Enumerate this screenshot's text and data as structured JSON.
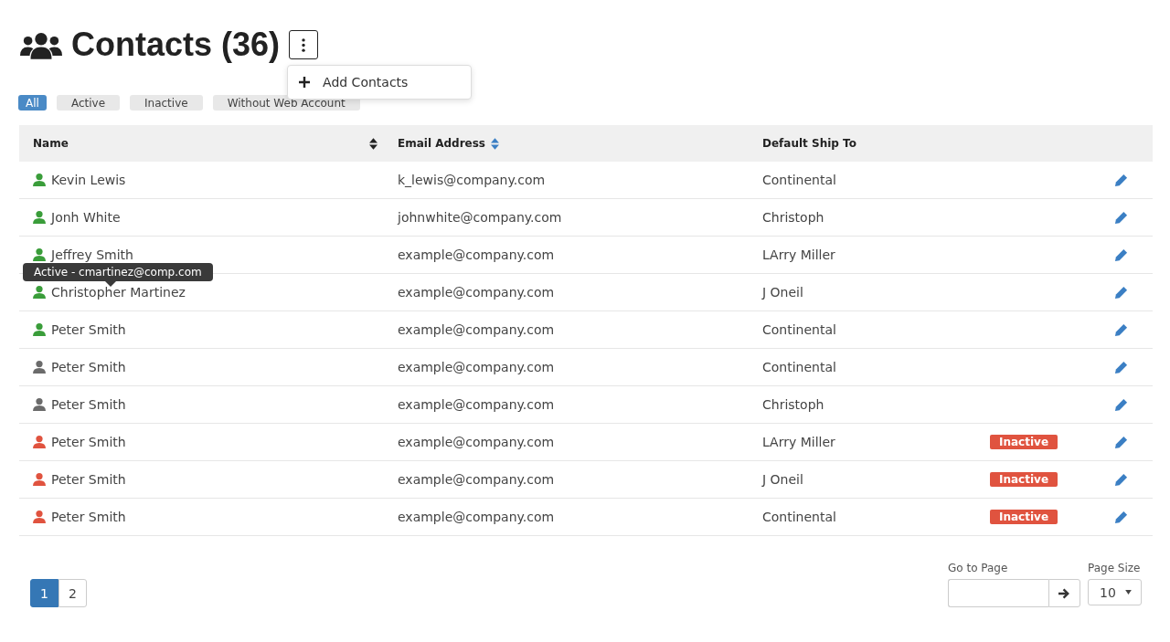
{
  "header": {
    "title": "Contacts (36)",
    "menu": [
      {
        "label": "Add Contacts"
      }
    ]
  },
  "filters": [
    {
      "label": "All",
      "selected": true
    },
    {
      "label": "Active",
      "selected": false
    },
    {
      "label": "Inactive",
      "selected": false
    },
    {
      "label": "Without Web Account",
      "selected": false
    }
  ],
  "table": {
    "columns": [
      {
        "label": "Name",
        "sorted": false
      },
      {
        "label": "Email Address",
        "sorted": true
      },
      {
        "label": "Default Ship To"
      }
    ],
    "rows": [
      {
        "name": "Kevin Lewis",
        "color": "#3a9d3a",
        "email": "k_lewis@company.com",
        "ship_to": "Continental"
      },
      {
        "name": "Jonh White",
        "color": "#3a9d3a",
        "email": "johnwhite@company.com",
        "ship_to": "Christoph"
      },
      {
        "name": "Jeffrey Smith",
        "color": "#3a9d3a",
        "email": "example@company.com",
        "ship_to": "LArry Miller"
      },
      {
        "name": "Christopher Martinez",
        "color": "#3a9d3a",
        "email": "example@company.com",
        "ship_to": "J Oneil"
      },
      {
        "name": "Peter Smith",
        "color": "#3a9d3a",
        "email": "example@company.com",
        "ship_to": "Continental"
      },
      {
        "name": "Peter Smith",
        "color": "#6b6b6b",
        "email": "example@company.com",
        "ship_to": "Continental"
      },
      {
        "name": "Peter Smith",
        "color": "#6b6b6b",
        "email": "example@company.com",
        "ship_to": "Christoph"
      },
      {
        "name": "Peter Smith",
        "color": "#e0533f",
        "email": "example@company.com",
        "ship_to": "LArry Miller",
        "badge": "Inactive"
      },
      {
        "name": "Peter Smith",
        "color": "#e0533f",
        "email": "example@company.com",
        "ship_to": "J Oneil",
        "badge": "Inactive"
      },
      {
        "name": "Peter Smith",
        "color": "#e0533f",
        "email": "example@company.com",
        "ship_to": "Continental",
        "badge": "Inactive"
      }
    ]
  },
  "tooltip": {
    "text": "Active - cmartinez@comp.com"
  },
  "pagination": {
    "pages": [
      {
        "label": "1",
        "selected": true
      },
      {
        "label": "2",
        "selected": false
      }
    ],
    "go_to_page": {
      "label": "Go to Page"
    },
    "page_size": {
      "label": "Page Size",
      "value": "10"
    }
  }
}
